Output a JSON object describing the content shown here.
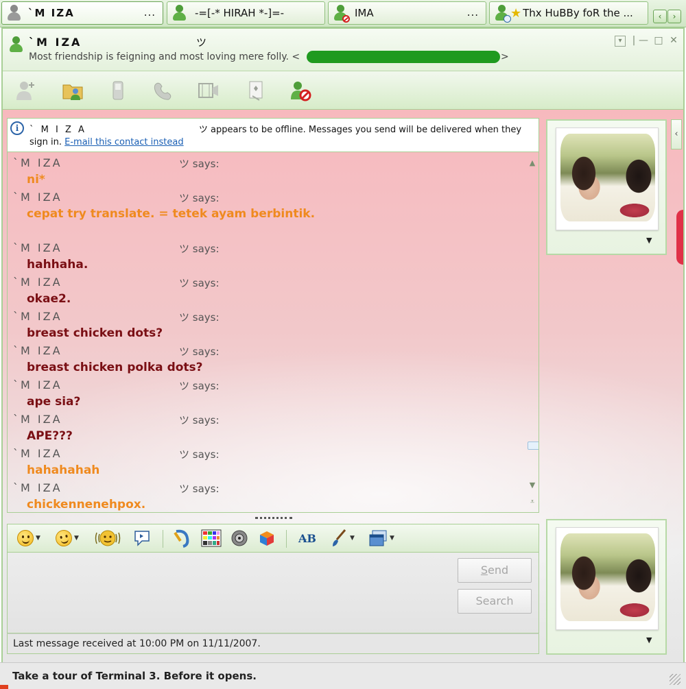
{
  "tabs": [
    {
      "label": "`M IZA",
      "ellipsis": "...",
      "icon": "user-gray-icon"
    },
    {
      "label": "-=[-* HIRAH *-]=-",
      "ellipsis": "",
      "icon": "user-green-icon"
    },
    {
      "label": "IMA",
      "ellipsis": "...",
      "icon": "user-blocked-icon"
    },
    {
      "label": "Thx HuBBy foR the ...",
      "ellipsis": "",
      "icon": "user-away-icon"
    }
  ],
  "tab_nav": {
    "prev": "‹",
    "next": "›"
  },
  "header": {
    "contact_name": "`M IZA",
    "contact_symbol": "ツ",
    "personal_message": "Most friendship is feigning and most loving mere folly. <",
    "message_end": ">",
    "window_controls": {
      "menu": "▾",
      "separator": "|",
      "minimize": "—",
      "maximize": "□",
      "close": "✕"
    }
  },
  "toolbar": [
    {
      "name": "invite-contact-button",
      "icon": "invite-icon"
    },
    {
      "name": "send-files-button",
      "icon": "folder-share-icon"
    },
    {
      "name": "voice-call-button",
      "icon": "phone-icon"
    },
    {
      "name": "call-phone-button",
      "icon": "handset-icon"
    },
    {
      "name": "video-call-button",
      "icon": "video-icon"
    },
    {
      "name": "games-button",
      "icon": "games-icon"
    },
    {
      "name": "block-contact-button",
      "icon": "block-icon"
    }
  ],
  "infobar": {
    "name": "` M I Z A",
    "symbol": "ツ",
    "text": "appears to be offline. Messages you send will be delivered when they",
    "text2": "sign in.",
    "link": "E-mail this contact instead",
    "info_glyph": "i"
  },
  "messages": [
    {
      "sender": "`M IZA",
      "says": "ツ says:",
      "text": "ni*",
      "color": "#ef8a1f"
    },
    {
      "sender": "`M IZA",
      "says": "ツ says:",
      "text": "cepat try translate. = tetek ayam berbintik.",
      "color": "#ef8a1f"
    },
    {
      "sender": "`M IZA",
      "says": "ツ says:",
      "text": "hahhaha.",
      "color": "#7a0f14"
    },
    {
      "sender": "`M IZA",
      "says": "ツ says:",
      "text": "okae2.",
      "color": "#7a0f14"
    },
    {
      "sender": "`M IZA",
      "says": "ツ says:",
      "text": "breast chicken dots?",
      "color": "#7a0f14"
    },
    {
      "sender": "`M IZA",
      "says": "ツ says:",
      "text": "breast chicken polka dots?",
      "color": "#7a0f14"
    },
    {
      "sender": "`M IZA",
      "says": "ツ says:",
      "text": "ape sia?",
      "color": "#7a0f14"
    },
    {
      "sender": "`M IZA",
      "says": "ツ says:",
      "text": "APE???",
      "color": "#7a0f14"
    },
    {
      "sender": "`M IZA",
      "says": "ツ says:",
      "text": "hahahahah",
      "color": "#ef8a1f"
    },
    {
      "sender": "`M IZA",
      "says": "ツ says:",
      "text": "chickennenehpox.",
      "color": "#ef8a1f"
    }
  ],
  "scrollbar": {
    "up": "▲",
    "down": "▼",
    "end": "⩡"
  },
  "format_toolbar": [
    {
      "name": "emoticon-button",
      "icon": "smiley-icon",
      "dropdown": true
    },
    {
      "name": "wink-button",
      "icon": "wink-icon",
      "dropdown": true
    },
    {
      "name": "nudge-button",
      "icon": "nudge-icon",
      "dropdown": false
    },
    {
      "name": "voice-clip-button",
      "icon": "voice-clip-icon",
      "dropdown": false
    },
    {
      "name": "ink-button",
      "icon": "ink-icon",
      "dropdown": false
    },
    {
      "name": "background-button",
      "icon": "background-grid-icon",
      "dropdown": false
    },
    {
      "name": "sound-button",
      "icon": "speaker-icon",
      "dropdown": false
    },
    {
      "name": "games-activity-button",
      "icon": "cube-icon",
      "dropdown": false
    },
    {
      "name": "font-button",
      "icon": "font-icon",
      "dropdown": false
    },
    {
      "name": "color-button",
      "icon": "brush-icon",
      "dropdown": true
    },
    {
      "name": "display-picture-button",
      "icon": "window-icon",
      "dropdown": true
    }
  ],
  "font_glyph": "A̶B",
  "input": {
    "send": "Send",
    "send_hotkey": "S",
    "send_rest": "end",
    "search": "Search"
  },
  "status_line": "Last message received at 10:00 PM on 11/11/2007.",
  "side": {
    "collapse": "‹",
    "panel_arrow": "▼"
  },
  "ad": "Take a tour of Terminal 3. Before it opens."
}
